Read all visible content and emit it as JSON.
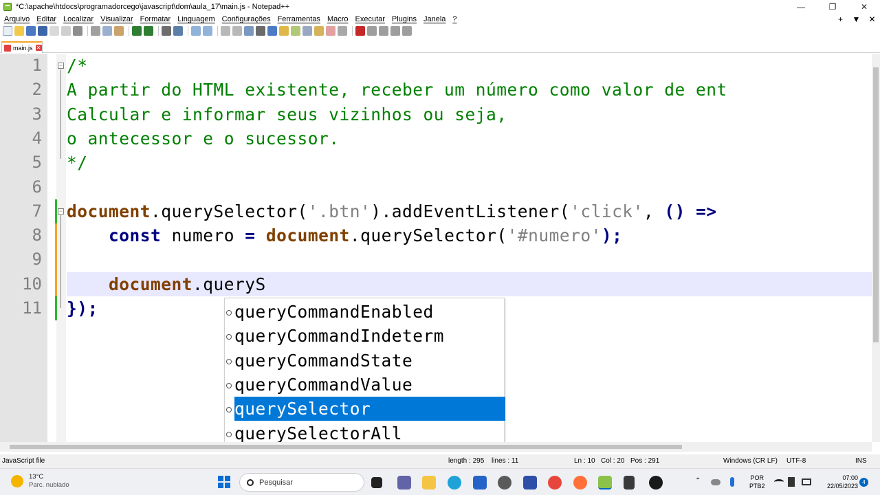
{
  "window": {
    "title": "*C:\\apache\\htdocs\\programadorcego\\javascript\\dom\\aula_17\\main.js - Notepad++",
    "controls": [
      "—",
      "❐",
      "✕"
    ]
  },
  "menubar": {
    "items": [
      "Arquivo",
      "Editar",
      "Localizar",
      "Visualizar",
      "Formatar",
      "Linguagem",
      "Configurações",
      "Ferramentas",
      "Macro",
      "Executar",
      "Plugins",
      "Janela",
      "?"
    ],
    "right": [
      "+",
      "▼",
      "✕"
    ]
  },
  "tabs": [
    {
      "label": "main.js",
      "active": true
    }
  ],
  "editor": {
    "line_numbers": [
      "1",
      "2",
      "3",
      "4",
      "5",
      "6",
      "7",
      "8",
      "9",
      "10",
      "11"
    ],
    "current_line": 10,
    "line1": "/*",
    "line2": "A partir do HTML existente, receber um número como valor de ent",
    "line3": "Calcular e informar seus vizinhos ou seja,",
    "line4": "o antecessor e o sucessor.",
    "line5": "*/",
    "line7": {
      "obj": "document",
      "dot1": ".querySelector(",
      "str1": "'.btn'",
      "dot2": ").addEventListener(",
      "str2": "'click'",
      "rest": ", ",
      "arrow": "() =>"
    },
    "line8": {
      "kw": "const",
      "name": " numero ",
      "eq": "=",
      "obj": "document",
      "call": ".querySelector(",
      "str": "'#numero'",
      "end": ");"
    },
    "line10": {
      "obj": "document",
      "typed": ".queryS"
    },
    "line11": "});"
  },
  "autocomplete": {
    "items": [
      "queryCommandEnabled",
      "queryCommandIndeterm",
      "queryCommandState",
      "queryCommandValue",
      "querySelector",
      "querySelectorAll"
    ],
    "selected": "querySelector"
  },
  "statusbar": {
    "filetype": "JavaScript file",
    "length": "length : 295",
    "lines": "lines : 11",
    "ln": "Ln : 10",
    "col": "Col : 20",
    "pos": "Pos : 291",
    "eol": "Windows (CR LF)",
    "encoding": "UTF-8",
    "mode": "INS"
  },
  "taskbar": {
    "weather_temp": "13°C",
    "weather_desc": "Parc. nublado",
    "search_placeholder": "Pesquisar",
    "lang1": "POR",
    "lang2": "PTB2",
    "time": "07:00",
    "date": "22/05/2023",
    "notifications": "4"
  },
  "colors": {
    "comment": "#008000",
    "keyword": "#000080",
    "object": "#804000",
    "string": "#808080",
    "current_line": "#e8e8ff",
    "selection": "#0078d7"
  }
}
